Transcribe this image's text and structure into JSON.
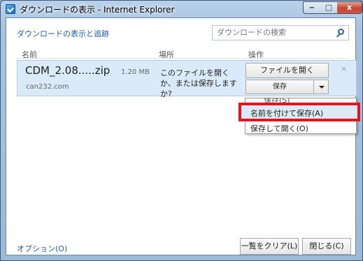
{
  "window": {
    "title": "ダウンロードの表示 - Internet Explorer",
    "controls": {
      "minimize": "‒",
      "maximize": "□",
      "close": "x"
    }
  },
  "header": {
    "title": "ダウンロードの表示と追跡",
    "search_placeholder": "ダウンロードの検索"
  },
  "columns": {
    "name": "名前",
    "location": "場所",
    "actions": "操作"
  },
  "download": {
    "filename": "CDM_2.08.....zip",
    "size": "1.20 MB",
    "site": "can232.com",
    "status": "このファイルを開くか、または保存しますか?",
    "open_label": "ファイルを開く",
    "save_label": "保存",
    "dismiss": "×"
  },
  "save_menu": {
    "items": [
      "保存(S)",
      "名前を付けて保存(A)",
      "保存して開く(O)"
    ]
  },
  "footer": {
    "options": "オプション(O)",
    "clear": "一覧をクリア(L)",
    "close": "閉じる(C)"
  }
}
